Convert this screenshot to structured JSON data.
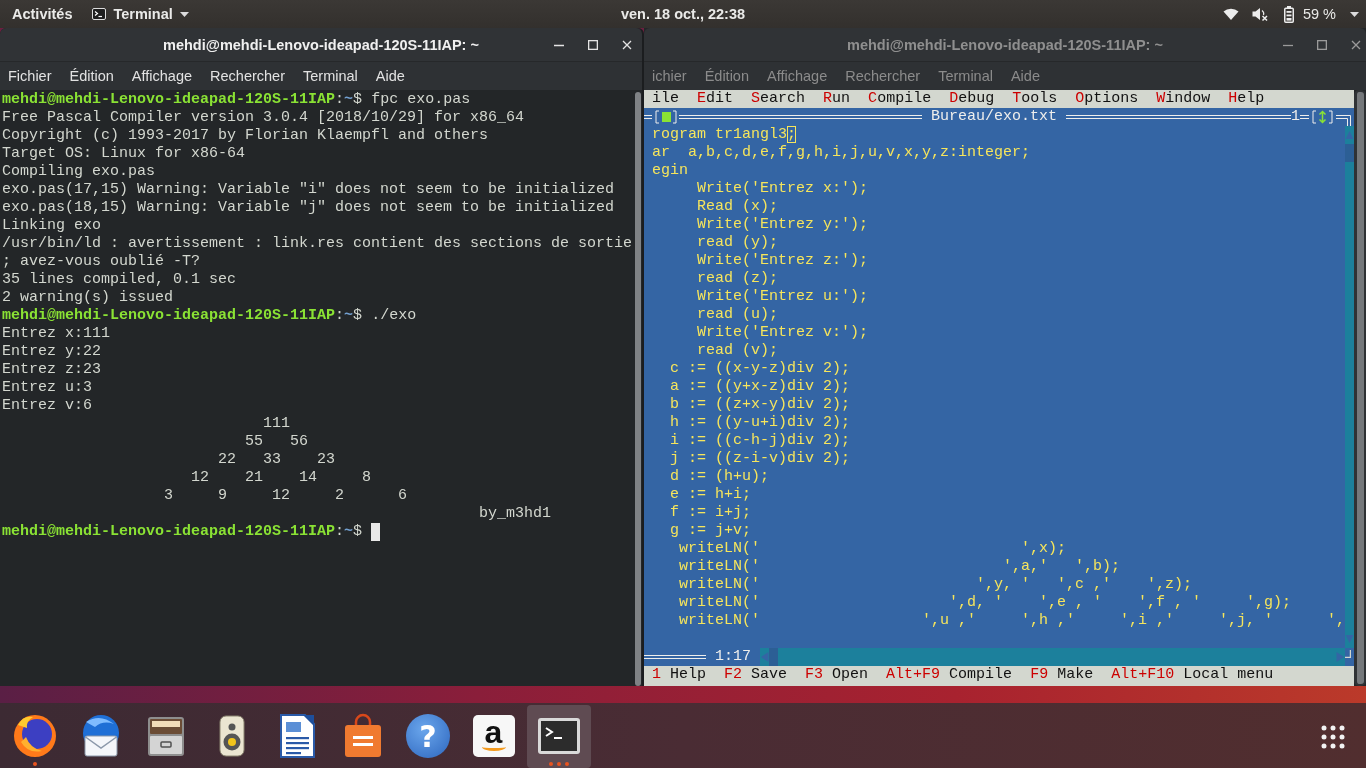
{
  "top_bar": {
    "activities": "Activités",
    "app_menu": "Terminal",
    "clock": "ven. 18 oct., 22:38",
    "battery": "59 %"
  },
  "windows": [
    {
      "kind": "shell",
      "focused": true,
      "title": "mehdi@mehdi-Lenovo-ideapad-120S-11IAP: ~",
      "menu": [
        "Fichier",
        "Édition",
        "Affichage",
        "Rechercher",
        "Terminal",
        "Aide"
      ],
      "lines": [
        {
          "kind": "prompt",
          "user_host": "mehdi@mehdi-Lenovo-ideapad-120S-11IAP",
          "separator": ":",
          "path": "~",
          "sign": "$",
          "command": "fpc exo.pas",
          "cursor": false
        },
        {
          "kind": "output",
          "text": "Free Pascal Compiler version 3.0.4 [2018/10/29] for x86_64"
        },
        {
          "kind": "output",
          "text": "Copyright (c) 1993-2017 by Florian Klaempfl and others"
        },
        {
          "kind": "output",
          "text": "Target OS: Linux for x86-64"
        },
        {
          "kind": "output",
          "text": "Compiling exo.pas"
        },
        {
          "kind": "output",
          "text": "exo.pas(17,15) Warning: Variable \"i\" does not seem to be initialized"
        },
        {
          "kind": "output",
          "text": "exo.pas(18,15) Warning: Variable \"j\" does not seem to be initialized"
        },
        {
          "kind": "output",
          "text": "Linking exo"
        },
        {
          "kind": "output",
          "text": "/usr/bin/ld : avertissement : link.res contient des sections de sortie"
        },
        {
          "kind": "output",
          "text": "; avez-vous oublié -T?"
        },
        {
          "kind": "output",
          "text": "35 lines compiled, 0.1 sec"
        },
        {
          "kind": "output",
          "text": "2 warning(s) issued"
        },
        {
          "kind": "prompt",
          "user_host": "mehdi@mehdi-Lenovo-ideapad-120S-11IAP",
          "separator": ":",
          "path": "~",
          "sign": "$",
          "command": "./exo",
          "cursor": false
        },
        {
          "kind": "output",
          "text": "Entrez x:111"
        },
        {
          "kind": "output",
          "text": "Entrez y:22"
        },
        {
          "kind": "output",
          "text": "Entrez z:23"
        },
        {
          "kind": "output",
          "text": "Entrez u:3"
        },
        {
          "kind": "output",
          "text": "Entrez v:6"
        },
        {
          "kind": "output",
          "text": "                             111"
        },
        {
          "kind": "output",
          "text": "                           55   56"
        },
        {
          "kind": "output",
          "text": "                        22   33    23"
        },
        {
          "kind": "output",
          "text": "                     12    21    14     8"
        },
        {
          "kind": "output",
          "text": "                  3     9     12     2      6"
        },
        {
          "kind": "output",
          "text": "                                                     by_m3hd1"
        },
        {
          "kind": "prompt",
          "user_host": "mehdi@mehdi-Lenovo-ideapad-120S-11IAP",
          "separator": ":",
          "path": "~",
          "sign": "$",
          "cursor": true
        }
      ]
    },
    {
      "kind": "ide",
      "focused": false,
      "title": "mehdi@mehdi-Lenovo-ideapad-120S-11IAP: ~",
      "menu": [
        "ichier",
        "Édition",
        "Affichage",
        "Rechercher",
        "Terminal",
        "Aide"
      ],
      "ide": {
        "menu": [
          {
            "label": "ile"
          },
          {
            "hotkey": "E",
            "label": "dit"
          },
          {
            "hotkey": "S",
            "label": "earch"
          },
          {
            "hotkey": "R",
            "label": "un"
          },
          {
            "hotkey": "C",
            "label": "ompile"
          },
          {
            "hotkey": "D",
            "label": "ebug"
          },
          {
            "hotkey": "T",
            "label": "ools"
          },
          {
            "hotkey": "O",
            "label": "ptions"
          },
          {
            "hotkey": "W",
            "label": "indow"
          },
          {
            "hotkey": "H",
            "label": "elp"
          }
        ],
        "file_title": "Bureau/exo.txt",
        "window_number": "1",
        "code": [
          {
            "text": "rogram tr1angl3",
            "cursor_char": ";"
          },
          {
            "text": "ar  a,b,c,d,e,f,g,h,i,j,u,v,x,y,z:integer;"
          },
          {
            "text": "egin"
          },
          {
            "text": "     Write('Entrez x:');"
          },
          {
            "text": "     Read (x);"
          },
          {
            "text": "     Write('Entrez y:');"
          },
          {
            "text": "     read (y);"
          },
          {
            "text": "     Write('Entrez z:');"
          },
          {
            "text": "     read (z);"
          },
          {
            "text": "     Write('Entrez u:');"
          },
          {
            "text": "     read (u);"
          },
          {
            "text": "     Write('Entrez v:');"
          },
          {
            "text": "     read (v);"
          },
          {
            "text": "  c := ((x-y-z)div 2);"
          },
          {
            "text": "  a := ((y+x-z)div 2);"
          },
          {
            "text": "  b := ((z+x-y)div 2);"
          },
          {
            "text": "  h := ((y-u+i)div 2);"
          },
          {
            "text": "  i := ((c-h-j)div 2);"
          },
          {
            "text": "  j := ((z-i-v)div 2);"
          },
          {
            "text": "  d := (h+u);"
          },
          {
            "text": "  e := h+i;"
          },
          {
            "text": "  f := i+j;"
          },
          {
            "text": "  g := j+v;"
          },
          {
            "text": "   writeLN('                             ',x);"
          },
          {
            "text": "   writeLN('                           ',a,'   ',b);"
          },
          {
            "text": "   writeLN('                        ',y, '   ',c ,'    ',z);"
          },
          {
            "text": "   writeLN('                     ',d, '    ',e , '    ',f , '     ',g);"
          },
          {
            "text": "   writeLN('                  ',u ,'     ',h ,'     ',i ,'     ',j, '      ',"
          }
        ],
        "position": "1:17",
        "keys": [
          {
            "key": "1",
            "label": "Help"
          },
          {
            "key": "F2",
            "label": "Save"
          },
          {
            "key": "F3",
            "label": "Open"
          },
          {
            "key": "Alt+F9",
            "label": "Compile"
          },
          {
            "key": "F9",
            "label": "Make"
          },
          {
            "key": "Alt+F10",
            "label": "Local menu"
          }
        ]
      }
    }
  ],
  "dock": {
    "items": [
      {
        "kind": "globe",
        "focused": false,
        "running": true,
        "several_windows": false
      },
      {
        "kind": "mail",
        "focused": false,
        "running": false,
        "several_windows": false
      },
      {
        "kind": "files",
        "focused": false,
        "running": false,
        "several_windows": false
      },
      {
        "kind": "speaker",
        "focused": false,
        "running": false,
        "several_windows": false
      },
      {
        "kind": "document",
        "focused": false,
        "running": false,
        "several_windows": false
      },
      {
        "kind": "bag",
        "focused": false,
        "running": false,
        "several_windows": false
      },
      {
        "kind": "help",
        "glyph": "?",
        "focused": false,
        "running": false,
        "several_windows": false
      },
      {
        "kind": "letter",
        "glyph": "a",
        "focused": false,
        "running": false,
        "several_windows": false
      },
      {
        "kind": "terminal",
        "focused": true,
        "running": true,
        "several_windows": true
      }
    ]
  }
}
